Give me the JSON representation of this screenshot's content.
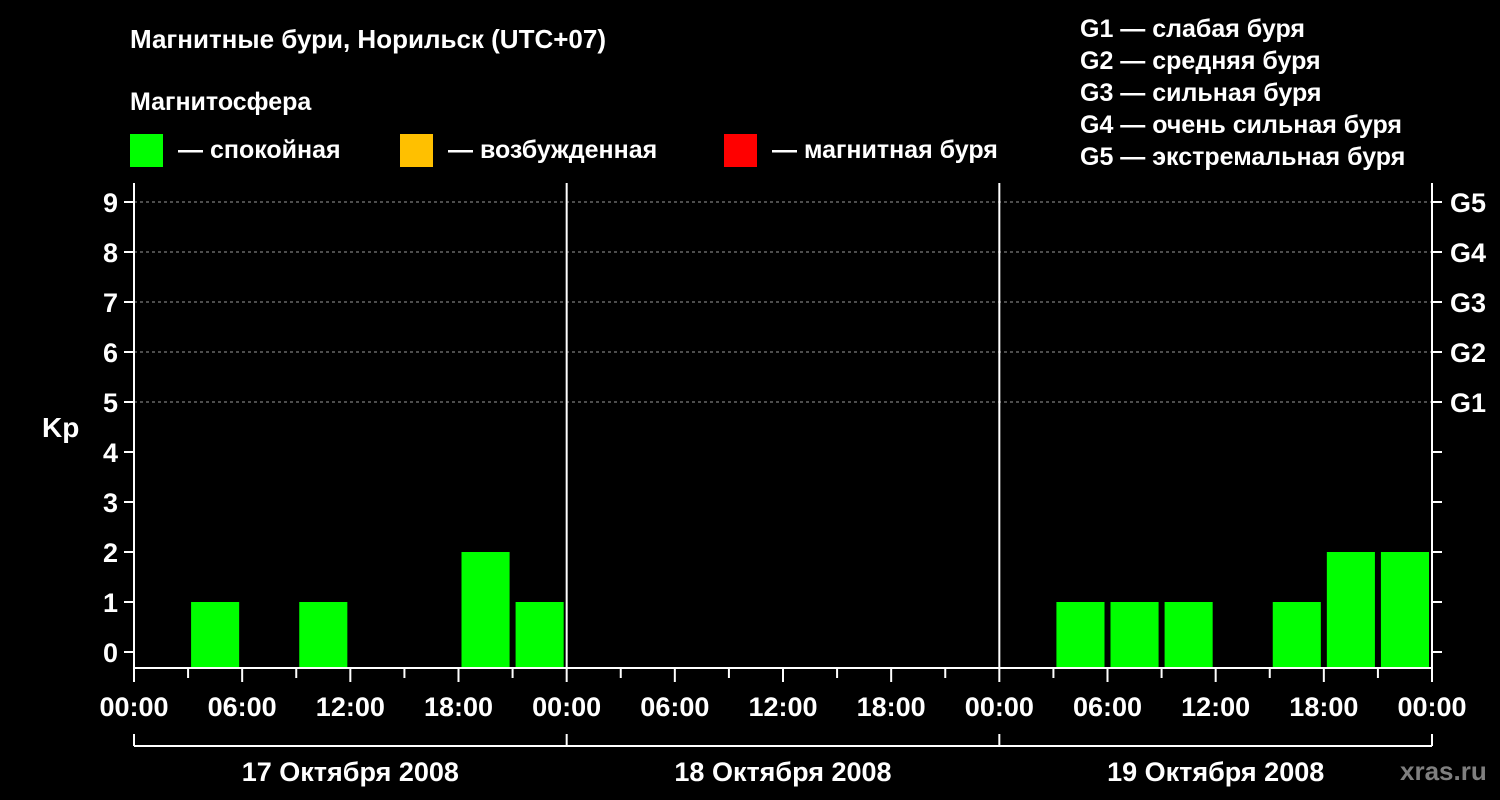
{
  "title": "Магнитные бури, Норильск (UTC+07)",
  "legend": {
    "heading": "Магнитосфера",
    "items": [
      {
        "label": "— спокойная",
        "color": "#00ff00"
      },
      {
        "label": "— возбужденная",
        "color": "#ffc000"
      },
      {
        "label": "— магнитная буря",
        "color": "#ff0000"
      }
    ],
    "storm_levels": [
      "G1 — слабая буря",
      "G2 — средняя буря",
      "G3 — сильная буря",
      "G4 — очень сильная буря",
      "G5 — экстремальная буря"
    ]
  },
  "watermark": "xras.ru",
  "chart_data": {
    "type": "bar",
    "ylabel": "Kp",
    "ylim": [
      0,
      9
    ],
    "y_ticks": [
      "0",
      "1",
      "2",
      "3",
      "4",
      "5",
      "6",
      "7",
      "8",
      "9"
    ],
    "y_gridlines": [
      5,
      6,
      7,
      8,
      9
    ],
    "right_axis_labels": [
      {
        "kp": 5,
        "label": "G1"
      },
      {
        "kp": 6,
        "label": "G2"
      },
      {
        "kp": 7,
        "label": "G3"
      },
      {
        "kp": 8,
        "label": "G4"
      },
      {
        "kp": 9,
        "label": "G5"
      }
    ],
    "x_tick_labels": [
      "00:00",
      "06:00",
      "12:00",
      "18:00",
      "00:00",
      "06:00",
      "12:00",
      "18:00",
      "00:00",
      "06:00",
      "12:00",
      "18:00",
      "00:00"
    ],
    "days": [
      "17 Октября 2008",
      "18 Октября 2008",
      "19 Октября 2008"
    ],
    "bar_color": "#00ff00",
    "series": [
      {
        "values": [
          {
            "day": "17 Октября 2008",
            "start_hour": 3,
            "kp": 1
          },
          {
            "day": "17 Октября 2008",
            "start_hour": 9,
            "kp": 1
          },
          {
            "day": "17 Октября 2008",
            "start_hour": 18,
            "kp": 2
          },
          {
            "day": "17 Октября 2008",
            "start_hour": 21,
            "kp": 1
          },
          {
            "day": "19 Октября 2008",
            "start_hour": 3,
            "kp": 1
          },
          {
            "day": "19 Октября 2008",
            "start_hour": 6,
            "kp": 1
          },
          {
            "day": "19 Октября 2008",
            "start_hour": 9,
            "kp": 1
          },
          {
            "day": "19 Октября 2008",
            "start_hour": 15,
            "kp": 1
          },
          {
            "day": "19 Октября 2008",
            "start_hour": 18,
            "kp": 2
          },
          {
            "day": "19 Октября 2008",
            "start_hour": 21,
            "kp": 2
          }
        ]
      }
    ]
  }
}
